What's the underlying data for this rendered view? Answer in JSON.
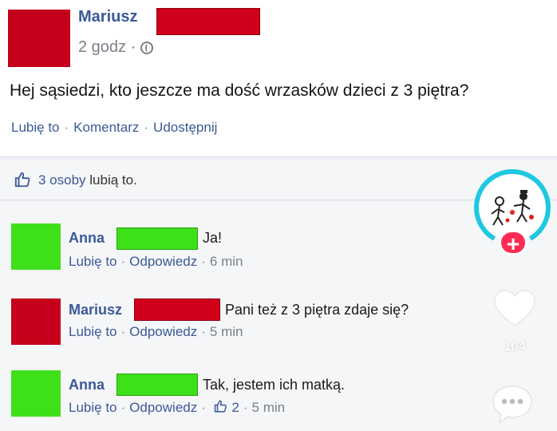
{
  "post": {
    "author": "Mariusz",
    "time": "2 godz ·",
    "text": "Hej sąsiedzi, kto jeszcze ma dość wrzasków dzieci z 3 piętra?",
    "actions": {
      "like": "Lubię to",
      "comment": "Komentarz",
      "share": "Udostępnij",
      "separator": "·"
    }
  },
  "likes": {
    "count_text": "3 osoby",
    "suffix": "lubią to."
  },
  "comments": [
    {
      "name": "Anna",
      "text": "Ja!",
      "like": "Lubię to",
      "reply": "Odpowiedz",
      "time": "6 min",
      "avatar_color": "#3ee01a"
    },
    {
      "name": "Mariusz",
      "text": "Pani też z 3 piętra zdaje się?",
      "like": "Lubię to",
      "reply": "Odpowiedz",
      "time": "5 min",
      "avatar_color": "#c4001a"
    },
    {
      "name": "Anna",
      "text": "Tak, jestem ich matką.",
      "like": "Lubię to",
      "reply": "Odpowiedz",
      "reactions": "2",
      "time": "5 min",
      "avatar_color": "#3ee01a"
    }
  ],
  "tiktok": {
    "like_count": "104",
    "icons": [
      "profile-avatar",
      "follow-plus-icon",
      "heart-icon",
      "comment-bubble-icon"
    ]
  },
  "colors": {
    "link": "#3b5998",
    "redact_red": "#d0001a",
    "redact_green": "#3ee01a",
    "tiktok_plus": "#fe2c55"
  }
}
